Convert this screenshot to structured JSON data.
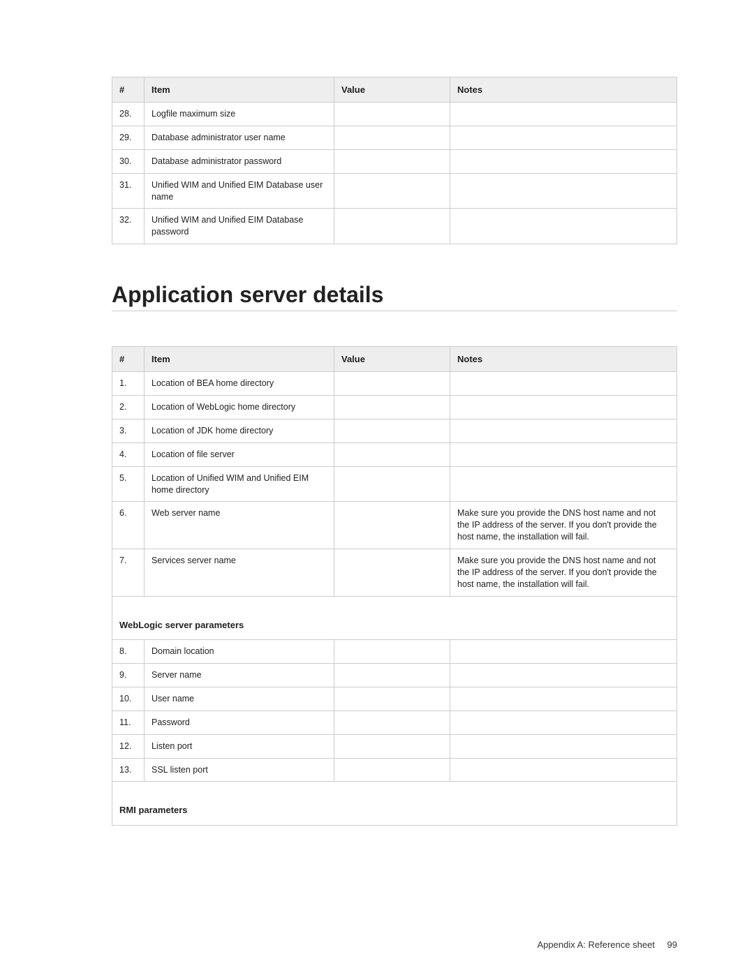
{
  "headers": {
    "num": "#",
    "item": "Item",
    "value": "Value",
    "notes": "Notes"
  },
  "table1": {
    "rows": [
      {
        "n": "28.",
        "item": "Logfile maximum size",
        "value": "",
        "notes": ""
      },
      {
        "n": "29.",
        "item": "Database administrator user name",
        "value": "",
        "notes": ""
      },
      {
        "n": "30.",
        "item": "Database administrator password",
        "value": "",
        "notes": ""
      },
      {
        "n": "31.",
        "item": "Unified WIM and Unified EIM Database user name",
        "value": "",
        "notes": ""
      },
      {
        "n": "32.",
        "item": "Unified WIM and Unified EIM Database password",
        "value": "",
        "notes": ""
      }
    ]
  },
  "heading": "Application server details",
  "table2": {
    "rows1": [
      {
        "n": "1.",
        "item": "Location of BEA home directory",
        "value": "",
        "notes": ""
      },
      {
        "n": "2.",
        "item": "Location of WebLogic home directory",
        "value": "",
        "notes": ""
      },
      {
        "n": "3.",
        "item": "Location of JDK home directory",
        "value": "",
        "notes": ""
      },
      {
        "n": "4.",
        "item": "Location of file server",
        "value": "",
        "notes": ""
      },
      {
        "n": "5.",
        "item": "Location of Unified WIM and Unified EIM home directory",
        "value": "",
        "notes": ""
      },
      {
        "n": "6.",
        "item": "Web server name",
        "value": "",
        "notes": "Make sure you provide the DNS host name and not the IP address of the server. If you don't provide the host name, the installation will fail."
      },
      {
        "n": "7.",
        "item": "Services server name",
        "value": "",
        "notes": "Make sure you provide the DNS host name and not the IP address of the server. If you don't provide the host name, the installation will fail."
      }
    ],
    "section1": "WebLogic server parameters",
    "rows2": [
      {
        "n": "8.",
        "item": "Domain location",
        "value": "",
        "notes": ""
      },
      {
        "n": "9.",
        "item": "Server name",
        "value": "",
        "notes": ""
      },
      {
        "n": "10.",
        "item": "User name",
        "value": "",
        "notes": ""
      },
      {
        "n": "11.",
        "item": "Password",
        "value": "",
        "notes": ""
      },
      {
        "n": "12.",
        "item": "Listen port",
        "value": "",
        "notes": ""
      },
      {
        "n": "13.",
        "item": "SSL listen port",
        "value": "",
        "notes": ""
      }
    ],
    "section2": "RMI parameters"
  },
  "footer": {
    "text": "Appendix A: Reference sheet",
    "page": "99"
  }
}
